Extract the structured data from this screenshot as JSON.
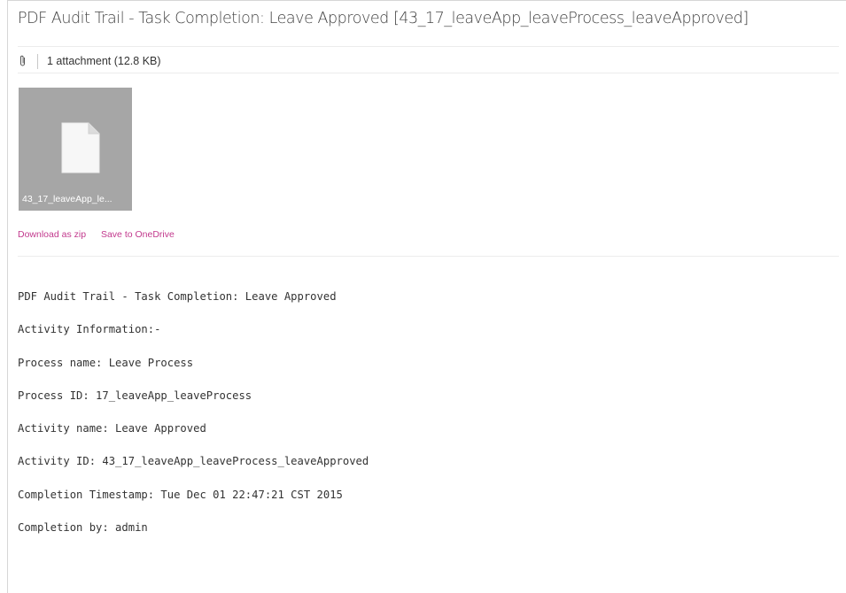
{
  "email": {
    "subject": "PDF Audit Trail - Task Completion: Leave Approved [43_17_leaveApp_leaveProcess_leaveApproved]",
    "attachments_summary": "1 attachment (12.8 KB)",
    "attachment": {
      "filename": "43_17_leaveApp_le...",
      "icon": "document-icon"
    },
    "actions": {
      "download_zip": "Download as zip",
      "save_onedrive": "Save to OneDrive"
    },
    "body_lines": [
      "PDF Audit Trail - Task Completion: Leave Approved",
      "Activity Information:-",
      "Process name: Leave Process",
      "Process ID: 17_leaveApp_leaveProcess",
      "Activity name: Leave Approved",
      "Activity ID: 43_17_leaveApp_leaveProcess_leaveApproved",
      "Completion Timestamp: Tue Dec 01 22:47:21 CST 2015",
      "Completion by: admin"
    ]
  },
  "colors": {
    "link": "#c2398d",
    "thumbnail_bg": "#a6a6a6",
    "separator": "#ececec"
  }
}
